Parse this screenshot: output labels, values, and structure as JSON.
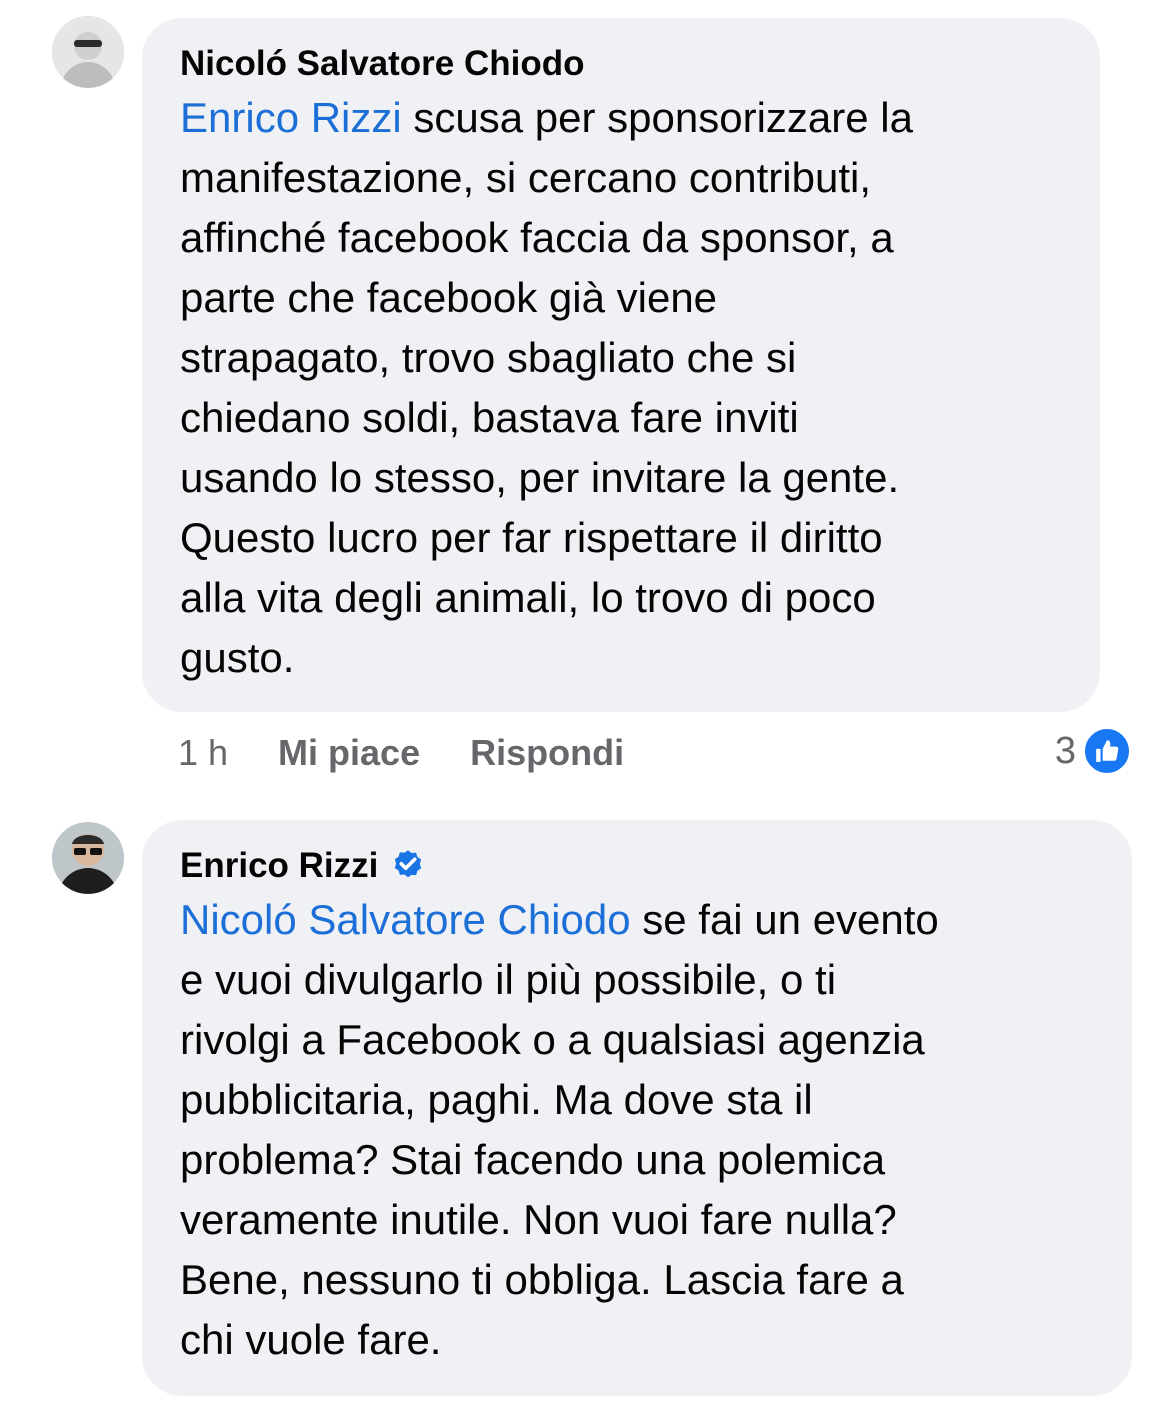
{
  "comments": [
    {
      "author": "Nicoló Salvatore Chiodo",
      "mention": "Enrico Rizzi",
      "text": " scusa per sponsorizzare la\nmanifestazione, si cercano contributi,\naffinché facebook faccia da sponsor, a\nparte che facebook già viene\nstrapagato, trovo sbagliato che si\nchiedano soldi, bastava fare inviti\nusando lo stesso, per invitare la gente.\nQuesto lucro per far rispettare il diritto\nalla vita degli animali, lo trovo di poco\ngusto.",
      "time": "1 h",
      "like_label": "Mi piace",
      "reply_label": "Rispondi",
      "reaction_count": "3",
      "reaction_icon": "thumbs-up-icon"
    },
    {
      "author": "Enrico Rizzi",
      "verified": true,
      "mention": "Nicoló Salvatore Chiodo",
      "text": " se fai un evento\ne vuoi divulgarlo il più possibile, o ti\nrivolgi a Facebook o a qualsiasi agenzia\npubblicitaria, paghi. Ma dove sta il\nproblema? Stai facendo una polemica\nveramente inutile. Non vuoi fare nulla?\nBene, nessuno ti obbliga. Lascia fare a\nchi vuole fare."
    }
  ],
  "colors": {
    "bubble_bg": "#f0f1f4",
    "mention": "#1b6fd6",
    "meta": "#65676b",
    "like_blue": "#1877f2"
  }
}
